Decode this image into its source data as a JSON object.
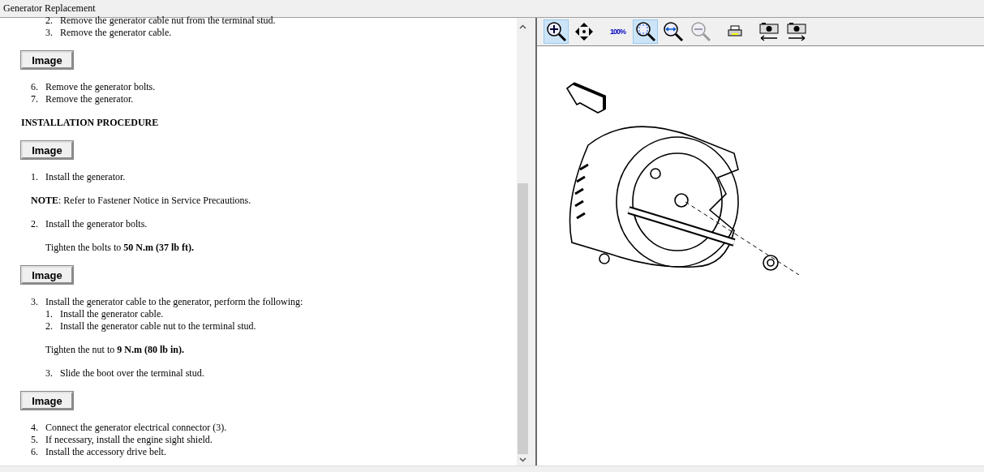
{
  "window": {
    "title": "Generator Replacement"
  },
  "document": {
    "blocks": [
      {
        "kind": "sublist",
        "items": [
          {
            "number": "2.",
            "text": "Remove the generator cable nut from the terminal stud."
          },
          {
            "number": "3.",
            "text": "Remove the generator cable."
          }
        ]
      },
      {
        "kind": "image_button",
        "label": "Image"
      },
      {
        "kind": "list",
        "items": [
          {
            "number": "6.",
            "text": "Remove the generator bolts."
          },
          {
            "number": "7.",
            "text": "Remove the generator."
          }
        ]
      },
      {
        "kind": "heading",
        "text": "INSTALLATION PROCEDURE"
      },
      {
        "kind": "image_button",
        "label": "Image"
      },
      {
        "kind": "list",
        "items": [
          {
            "number": "1.",
            "text": "Install the generator."
          }
        ]
      },
      {
        "kind": "note",
        "text": "**NOTE**:  Refer to Fastener Notice in Service Precautions."
      },
      {
        "kind": "list",
        "items": [
          {
            "number": "2.",
            "text": "Install the generator bolts."
          }
        ]
      },
      {
        "kind": "spec",
        "text": "Tighten the bolts to **50 N.m (37 lb ft).**"
      },
      {
        "kind": "image_button",
        "label": "Image"
      },
      {
        "kind": "list",
        "items": [
          {
            "number": "3.",
            "text": "Install the generator cable to the generator, perform the following:",
            "children": [
              {
                "number": "1.",
                "text": "Install the generator cable."
              },
              {
                "number": "2.",
                "text": "Install the generator cable nut to the terminal stud."
              }
            ]
          }
        ]
      },
      {
        "kind": "spec",
        "text": "Tighten the nut to **9 N.m (80 lb in).**"
      },
      {
        "kind": "sublist",
        "items": [
          {
            "number": "3.",
            "text": "Slide the boot over the terminal stud."
          }
        ]
      },
      {
        "kind": "image_button",
        "label": "Image"
      },
      {
        "kind": "list",
        "items": [
          {
            "number": "4.",
            "text": "Connect the generator electrical connector (3)."
          },
          {
            "number": "5.",
            "text": "If necessary, install the engine sight shield."
          },
          {
            "number": "6.",
            "text": "Install the accessory drive belt."
          }
        ]
      }
    ]
  },
  "toolbar": {
    "buttons": [
      {
        "kind": "zoom_in",
        "selected": true,
        "disabled": false
      },
      {
        "kind": "pan",
        "selected": false,
        "disabled": false
      },
      {
        "kind": "zoom_100",
        "label": "100%",
        "selected": false,
        "disabled": false
      },
      {
        "kind": "zoom_fit",
        "selected": true,
        "disabled": false
      },
      {
        "kind": "zoom_width",
        "selected": false,
        "disabled": false
      },
      {
        "kind": "zoom_out",
        "selected": false,
        "disabled": true
      },
      {
        "kind": "print",
        "selected": false,
        "disabled": false
      },
      {
        "kind": "prev_image",
        "selected": false,
        "disabled": false
      },
      {
        "kind": "next_image",
        "selected": false,
        "disabled": false
      }
    ]
  }
}
